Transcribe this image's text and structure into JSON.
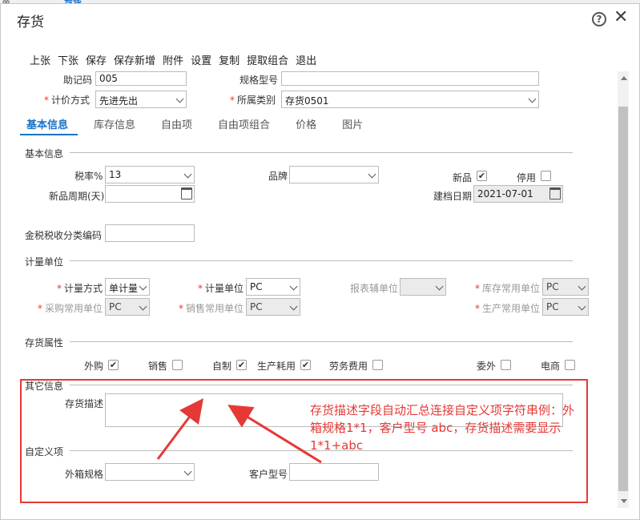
{
  "background": {
    "left_text": "单",
    "tab_text": "存货"
  },
  "dialog": {
    "title": "存货"
  },
  "toolbar": [
    "上张",
    "下张",
    "保存",
    "保存新增",
    "附件",
    "设置",
    "复制",
    "提取组合",
    "退出"
  ],
  "top_fields": {
    "mnemonic_label": "助记码",
    "mnemonic_value": "005",
    "spec_label": "规格型号",
    "spec_value": "",
    "pricing_label": "计价方式",
    "pricing_value": "先进先出",
    "category_label": "所属类别",
    "category_value": "存货0501"
  },
  "tabs": [
    "基本信息",
    "库存信息",
    "自由项",
    "自由项组合",
    "价格",
    "图片"
  ],
  "basic": {
    "section": "基本信息",
    "tax_label": "税率%",
    "tax_value": "13",
    "brand_label": "品牌",
    "brand_value": "",
    "new_label": "新品",
    "new_checked": "✔",
    "disabled_label": "停用",
    "cycle_label": "新品周期(天)",
    "created_label": "建档日期",
    "created_value": "2021-07-01",
    "tax_code_label": "金税税收分类编码"
  },
  "unit": {
    "section": "计量单位",
    "method_label": "计量方式",
    "method_value": "单计量",
    "unit_label": "计量单位",
    "unit_value": "PC",
    "report_label": "报表辅单位",
    "stock_label": "库存常用单位",
    "stock_value": "PC",
    "purchase_label": "采购常用单位",
    "purchase_value": "PC",
    "sales_label": "销售常用单位",
    "sales_value": "PC",
    "prod_label": "生产常用单位",
    "prod_value": "PC"
  },
  "attrs": {
    "section": "存货属性",
    "items": [
      {
        "label": "外购",
        "mark": "✔"
      },
      {
        "label": "销售",
        "mark": ""
      },
      {
        "label": "自制",
        "mark": "✔"
      },
      {
        "label": "生产耗用",
        "mark": "✔"
      },
      {
        "label": "劳务费用",
        "mark": ""
      },
      {
        "label": "委外",
        "mark": ""
      },
      {
        "label": "电商",
        "mark": ""
      }
    ]
  },
  "other": {
    "section": "其它信息",
    "desc_label": "存货描述"
  },
  "custom": {
    "section": "自定义项",
    "box_label": "外箱规格",
    "box_value": "",
    "model_label": "客户型号",
    "model_value": ""
  },
  "annotation": "存货描述字段自动汇总连接自定义项字符串例：外箱规格1*1，客户型号 abc，存货描述需要显示1*1+abc",
  "colors": {
    "accent": "#1a73c8",
    "annotation": "#e53935",
    "required": "#e33"
  }
}
